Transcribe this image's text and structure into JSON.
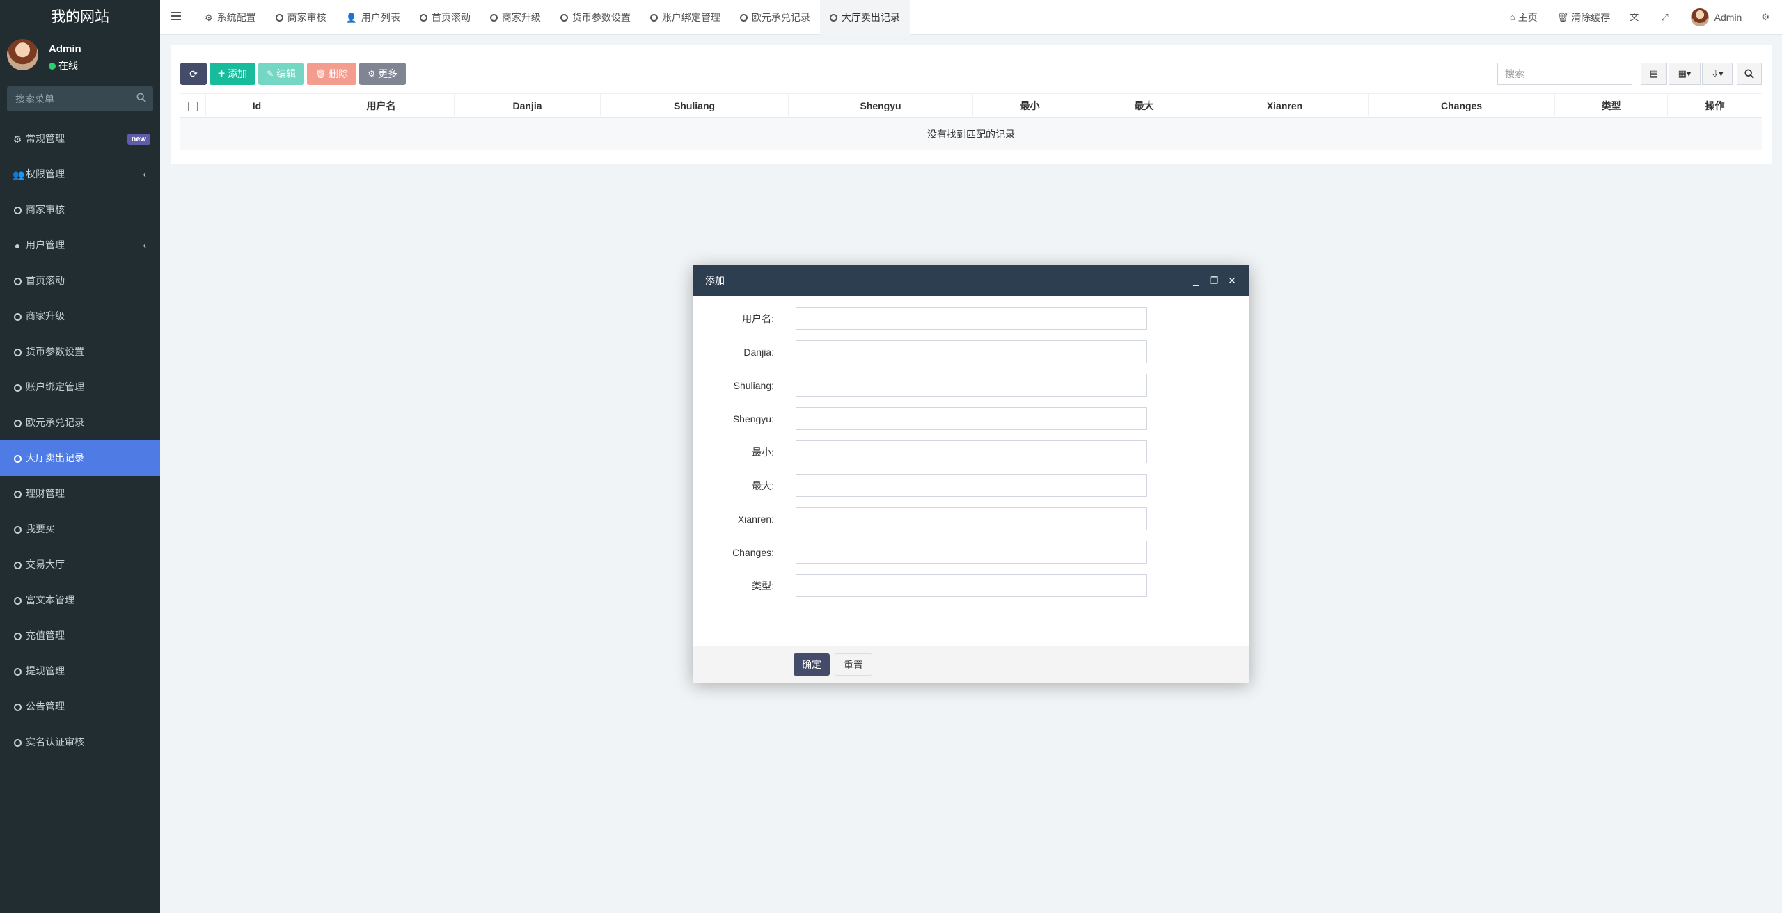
{
  "sidebar": {
    "brand": "我的网站",
    "user": {
      "name": "Admin",
      "status": "在线"
    },
    "search_placeholder": "搜索菜单",
    "badge_new": "new",
    "items": [
      {
        "label": "常规管理",
        "icon": "cogs-icon"
      },
      {
        "label": "权限管理",
        "icon": "group-icon"
      },
      {
        "label": "商家审核",
        "icon": "circle-icon"
      },
      {
        "label": "用户管理",
        "icon": "user-circle-icon"
      },
      {
        "label": "首页滚动",
        "icon": "circle-icon"
      },
      {
        "label": "商家升级",
        "icon": "circle-icon"
      },
      {
        "label": "货币参数设置",
        "icon": "circle-icon"
      },
      {
        "label": "账户绑定管理",
        "icon": "circle-icon"
      },
      {
        "label": "欧元承兑记录",
        "icon": "circle-icon"
      },
      {
        "label": "大厅卖出记录",
        "icon": "circle-icon"
      },
      {
        "label": "理财管理",
        "icon": "circle-icon"
      },
      {
        "label": "我要买",
        "icon": "circle-icon"
      },
      {
        "label": "交易大厅",
        "icon": "circle-icon"
      },
      {
        "label": "富文本管理",
        "icon": "circle-icon"
      },
      {
        "label": "充值管理",
        "icon": "circle-icon"
      },
      {
        "label": "提现管理",
        "icon": "circle-icon"
      },
      {
        "label": "公告管理",
        "icon": "circle-icon"
      },
      {
        "label": "实名认证审核",
        "icon": "circle-icon"
      }
    ]
  },
  "topnav": {
    "tabs": [
      {
        "label": "系统配置",
        "icon": "gear-icon"
      },
      {
        "label": "商家审核",
        "icon": "circle-icon"
      },
      {
        "label": "用户列表",
        "icon": "user-icon"
      },
      {
        "label": "首页滚动",
        "icon": "circle-icon"
      },
      {
        "label": "商家升级",
        "icon": "circle-icon"
      },
      {
        "label": "货币参数设置",
        "icon": "circle-icon"
      },
      {
        "label": "账户绑定管理",
        "icon": "circle-icon"
      },
      {
        "label": "欧元承兑记录",
        "icon": "circle-icon"
      },
      {
        "label": "大厅卖出记录",
        "icon": "circle-icon"
      }
    ],
    "home": "主页",
    "clear_cache": "清除缓存",
    "admin": "Admin"
  },
  "toolbar": {
    "add": "添加",
    "edit": "编辑",
    "delete": "删除",
    "more": "更多",
    "search_placeholder": "搜索"
  },
  "table": {
    "columns": [
      "Id",
      "用户名",
      "Danjia",
      "Shuliang",
      "Shengyu",
      "最小",
      "最大",
      "Xianren",
      "Changes",
      "类型",
      "操作"
    ],
    "empty_text": "没有找到匹配的记录"
  },
  "modal": {
    "title": "添加",
    "fields": [
      "用户名:",
      "Danjia:",
      "Shuliang:",
      "Shengyu:",
      "最小:",
      "最大:",
      "Xianren:",
      "Changes:",
      "类型:"
    ],
    "confirm": "确定",
    "reset": "重置"
  },
  "colors": {
    "sidebar_bg": "#222d32",
    "active_item": "#4f7be5",
    "modal_header": "#2c3e50",
    "success": "#18bc9c",
    "danger_disabled": "#f49d8e",
    "primary_dark": "#444c69"
  }
}
